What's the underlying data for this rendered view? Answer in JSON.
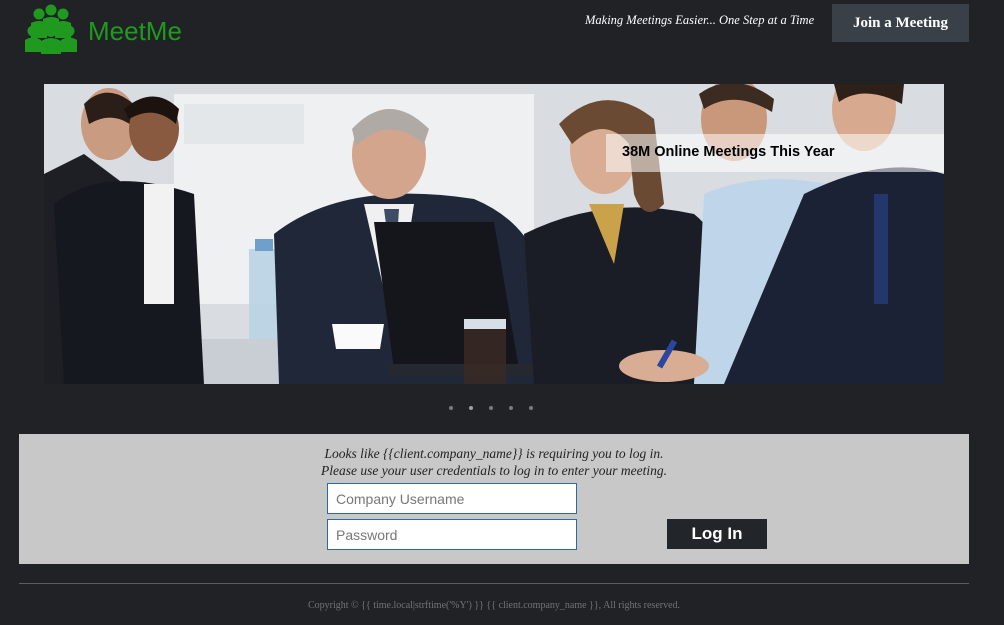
{
  "header": {
    "logo_text": "MeetMe",
    "logo_icon": "people-group-icon",
    "tagline": "Making Meetings Easier... One Step at a Time",
    "join_button": "Join a Meeting"
  },
  "hero": {
    "caption": "38M Online Meetings This Year",
    "image": "business-meeting-photo",
    "slides": 5,
    "active_slide": 2
  },
  "login": {
    "message_line1": "Looks like {{client.company_name}} is requiring you to log in.",
    "message_line2": "Please use your user credentials to log in to enter your meeting.",
    "username_placeholder": "Company Username",
    "password_placeholder": "Password",
    "login_button": "Log In"
  },
  "footer": {
    "copyright": "Copyright © {{ time.local|strftime('%Y') }} {{ client.company_name }}, All rights reserved."
  },
  "colors": {
    "background": "#202226",
    "brand_green": "#1f9a1f",
    "panel": "#c8c8c8",
    "button_dark": "#22252a",
    "join_button": "#3a4048"
  }
}
